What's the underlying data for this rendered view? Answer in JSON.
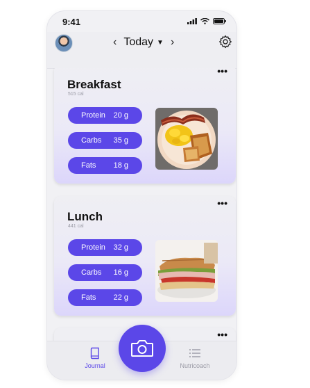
{
  "status_bar": {
    "time": "9:41"
  },
  "header": {
    "date_label": "Today",
    "prev_icon": "chevron-left-icon",
    "next_icon": "chevron-right-icon"
  },
  "meals": [
    {
      "title": "Breakfast",
      "calories": "515 cal",
      "macros": [
        {
          "name": "Protein",
          "value": "20 g"
        },
        {
          "name": "Carbs",
          "value": "35 g"
        },
        {
          "name": "Fats",
          "value": "18 g"
        }
      ]
    },
    {
      "title": "Lunch",
      "calories": "441 cal",
      "macros": [
        {
          "name": "Protein",
          "value": "32 g"
        },
        {
          "name": "Carbs",
          "value": "16 g"
        },
        {
          "name": "Fats",
          "value": "22 g"
        }
      ]
    }
  ],
  "bottom_nav": {
    "journal_label": "Journal",
    "coach_label": "Nutricoach"
  },
  "colors": {
    "accent": "#5b47e8",
    "inactive": "#9a9aa5"
  }
}
